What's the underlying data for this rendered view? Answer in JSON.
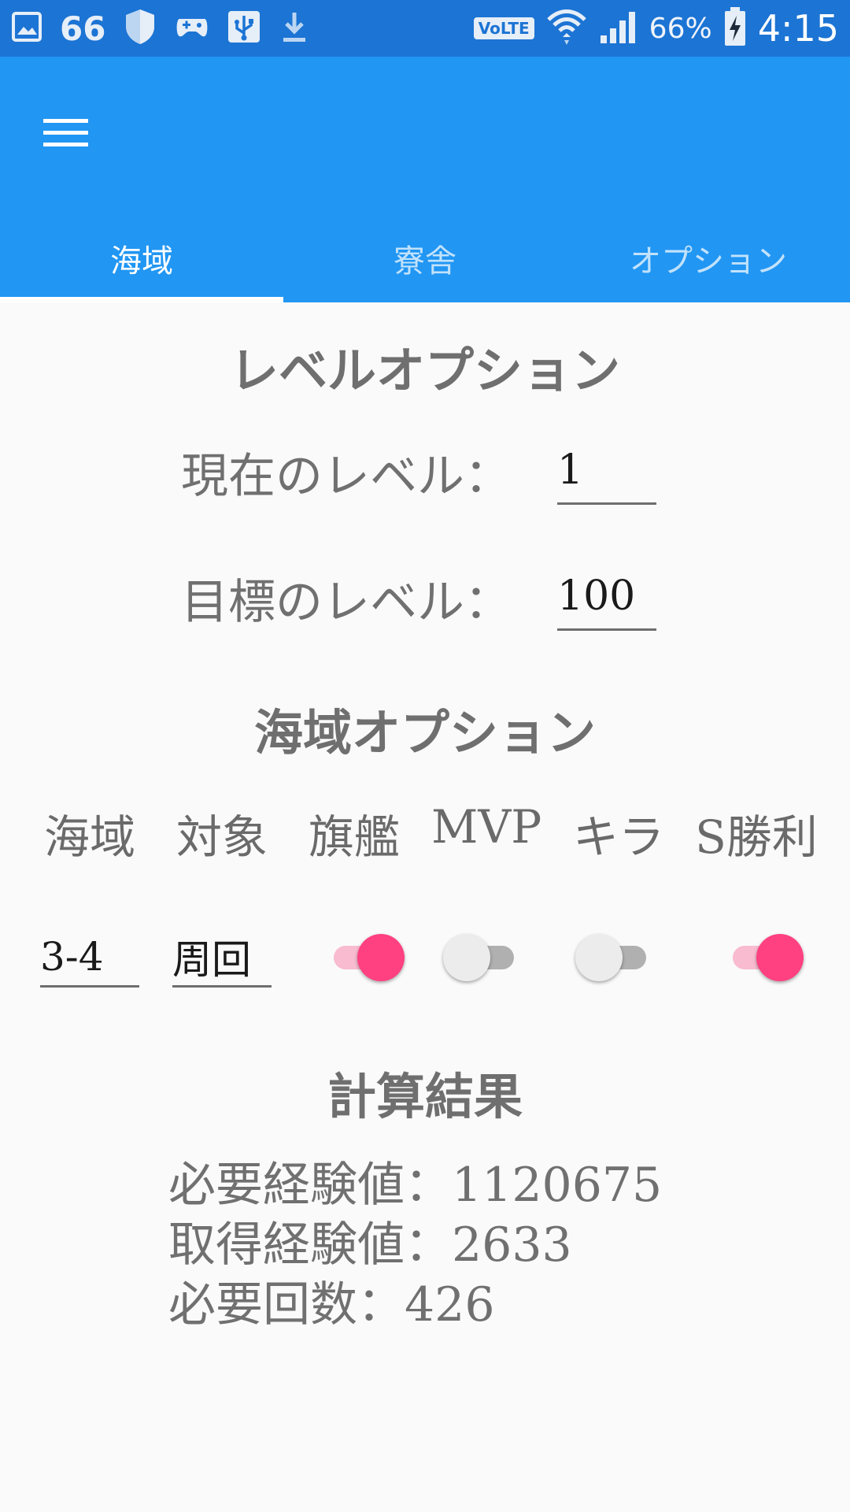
{
  "status_bar": {
    "notification_count": "66",
    "battery": "66%",
    "time": "4:15",
    "network_badge": "VoLTE",
    "icons": [
      "gallery-icon",
      "shield-icon",
      "game-controller-icon",
      "usb-icon",
      "download-icon",
      "wifi-icon",
      "signal-icon",
      "battery-charging-icon"
    ]
  },
  "app_bar": {
    "menu_icon": "hamburger-menu-icon",
    "color": "#2196f3",
    "tabs": [
      {
        "label": "海域",
        "active": true
      },
      {
        "label": "寮舎",
        "active": false
      },
      {
        "label": "オプション",
        "active": false
      }
    ]
  },
  "level_options": {
    "title": "レベルオプション",
    "current_label": "現在のレベル：",
    "current_value": "1",
    "target_label": "目標のレベル：",
    "target_value": "100"
  },
  "sea_options": {
    "title": "海域オプション",
    "columns": [
      "海域",
      "対象",
      "旗艦",
      "MVP",
      "キラ",
      "S勝利"
    ],
    "sea_value": "3-4",
    "target_value": "周回",
    "switches": [
      {
        "name": "旗艦",
        "on": true
      },
      {
        "name": "MVP",
        "on": false
      },
      {
        "name": "キラ",
        "on": false
      },
      {
        "name": "S勝利",
        "on": true
      }
    ],
    "accent_color": "#ff4081"
  },
  "results": {
    "title": "計算結果",
    "lines": [
      "必要経験値：1120675",
      "取得経験値：2633",
      "必要回数：426"
    ]
  }
}
